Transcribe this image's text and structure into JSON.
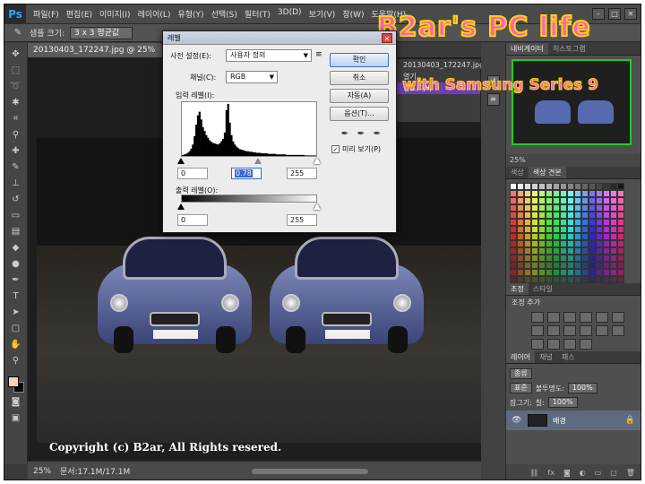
{
  "app": {
    "logo": "Ps"
  },
  "menu": [
    "파일(F)",
    "편집(E)",
    "이미지(I)",
    "레이어(L)",
    "유형(Y)",
    "선택(S)",
    "필터(T)",
    "3D(D)",
    "보기(V)",
    "창(W)",
    "도움말(H)"
  ],
  "options_bar": {
    "sample_size_label": "샘플 크기:",
    "sample_size_value": "3 x 3 평균값"
  },
  "document": {
    "tab_title": "20130403_172247.jpg @ 25% (RGB/8) *",
    "zoom": "25%",
    "doc_info": "문서:17.1M/17.1M"
  },
  "watermark": {
    "line1": "B2ar's PC life",
    "line2": "with Samsung Series 9",
    "copyright": "Copyright (c) B2ar, All Rights resered."
  },
  "history": {
    "items": [
      "20130403_172247.jpg",
      "열기",
      "명도/대비"
    ],
    "active_index": 2
  },
  "levels_dialog": {
    "title": "레벨",
    "preset_label": "사전 설정(E):",
    "preset_value": "사용자 정의",
    "channel_label": "채널(C):",
    "channel_value": "RGB",
    "input_levels_label": "입력 레벨(I):",
    "input_black": "0",
    "input_gamma": "0.78",
    "input_white": "255",
    "output_levels_label": "출력 레벨(O):",
    "output_black": "0",
    "output_white": "255",
    "ok_label": "확인",
    "cancel_label": "취소",
    "auto_label": "자동(A)",
    "options_label": "옵션(T)...",
    "preview_label": "미리 보기(P)",
    "preview_checked": true,
    "histogram": [
      2,
      3,
      4,
      6,
      9,
      14,
      22,
      38,
      60,
      78,
      85,
      70,
      55,
      48,
      40,
      35,
      30,
      27,
      25,
      24,
      23,
      22,
      24,
      28,
      33,
      45,
      88,
      100,
      64,
      40,
      28,
      22,
      18,
      15,
      13,
      12,
      11,
      10,
      9,
      9,
      8,
      8,
      7,
      7,
      6,
      6,
      6,
      5,
      5,
      5,
      5,
      4,
      4,
      4,
      4,
      4,
      3,
      3,
      3,
      3,
      3,
      3,
      2,
      2,
      2,
      2,
      2,
      2,
      2,
      2,
      2,
      2,
      2,
      1,
      1,
      1,
      1,
      1,
      1,
      1
    ]
  },
  "panels": {
    "navigator_tabs": [
      "내비게이터",
      "히스토그램"
    ],
    "navigator_zoom": "25%",
    "swatch_tabs": [
      "색상",
      "색상 견본"
    ],
    "adjust_tabs": [
      "조정",
      "스타일"
    ],
    "adjust_title": "조정 추가",
    "layers_tabs": [
      "레이어",
      "채널",
      "패스"
    ],
    "layers_kind": "종류",
    "blend_mode": "표준",
    "opacity_label": "불투명도:",
    "opacity_value": "100%",
    "lock_label": "잠그기:",
    "fill_label": "칠:",
    "fill_value": "100%",
    "layer_name": "배경"
  },
  "colors": {
    "accent": "#22cc22",
    "history_active": "#6a3dbf",
    "watermark_pink": "#ff5cc8",
    "watermark_yellow": "#ffd400"
  }
}
